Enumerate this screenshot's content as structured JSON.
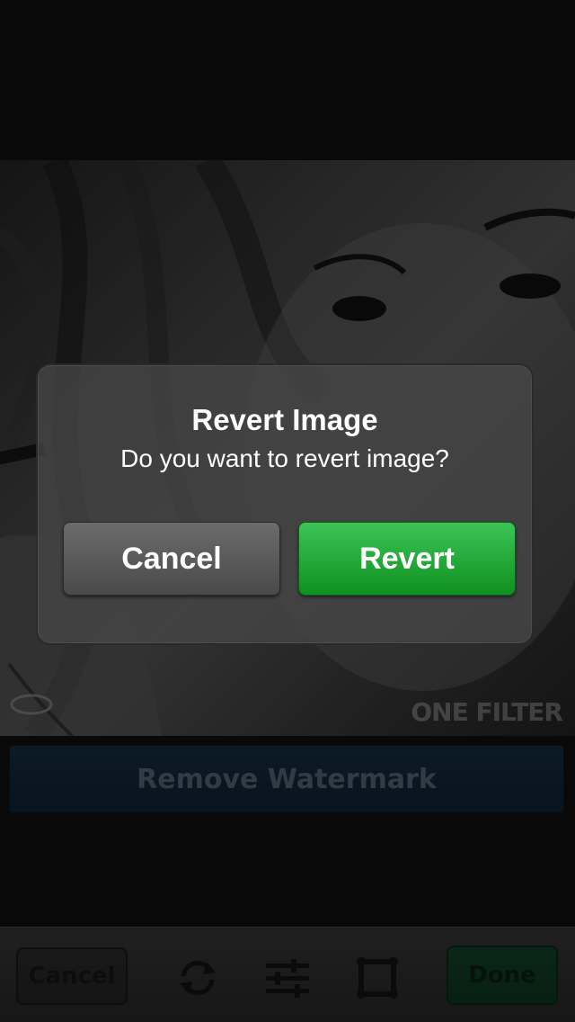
{
  "editor": {
    "watermark_text": "ONE FILTER",
    "remove_watermark_label": "Remove Watermark"
  },
  "toolbar": {
    "cancel_label": "Cancel",
    "done_label": "Done",
    "icons": [
      "refresh-icon",
      "adjust-sliders-icon",
      "frame-border-icon"
    ]
  },
  "dialog": {
    "title": "Revert Image",
    "message": "Do you want to revert image?",
    "cancel_label": "Cancel",
    "confirm_label": "Revert"
  },
  "colors": {
    "confirm_green": "#1fa836",
    "remove_watermark_blue": "#14304a",
    "done_green": "#14472c"
  }
}
